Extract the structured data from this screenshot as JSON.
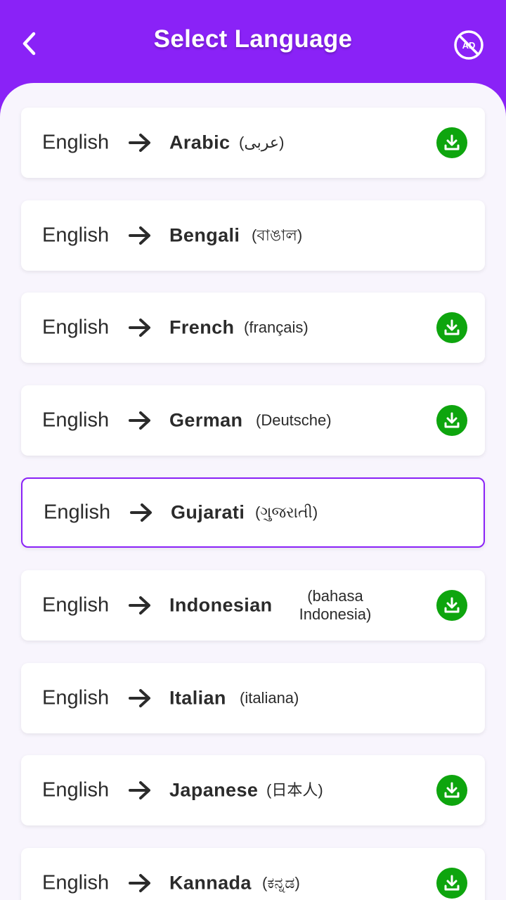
{
  "header": {
    "title": "Select Language",
    "background": "#8a22f7"
  },
  "colors": {
    "accent": "#8a22f7",
    "download": "#0ea50e",
    "text": "#2b2b2b"
  },
  "languages": [
    {
      "source": "English",
      "target": "Arabic",
      "native": "(عربى)",
      "downloadable": true,
      "selected": false
    },
    {
      "source": "English",
      "target": "Bengali",
      "native": "(বাঙাল)",
      "downloadable": false,
      "selected": false
    },
    {
      "source": "English",
      "target": "French",
      "native": "(français)",
      "downloadable": true,
      "selected": false
    },
    {
      "source": "English",
      "target": "German",
      "native": "(Deutsche)",
      "downloadable": true,
      "selected": false
    },
    {
      "source": "English",
      "target": "Gujarati",
      "native": "(ગુજરાતી)",
      "downloadable": false,
      "selected": true
    },
    {
      "source": "English",
      "target": "Indonesian",
      "native": "(bahasa Indonesia)",
      "downloadable": true,
      "selected": false
    },
    {
      "source": "English",
      "target": "Italian",
      "native": "(italiana)",
      "downloadable": false,
      "selected": false
    },
    {
      "source": "English",
      "target": "Japanese",
      "native": "(日本人)",
      "downloadable": true,
      "selected": false
    },
    {
      "source": "English",
      "target": "Kannada",
      "native": "(ಕನ್ನಡ)",
      "downloadable": true,
      "selected": false
    }
  ],
  "icons": {
    "back": "chevron-left-icon",
    "no_ads": "no-ads-icon",
    "arrow": "arrow-right-icon",
    "download": "download-icon"
  }
}
